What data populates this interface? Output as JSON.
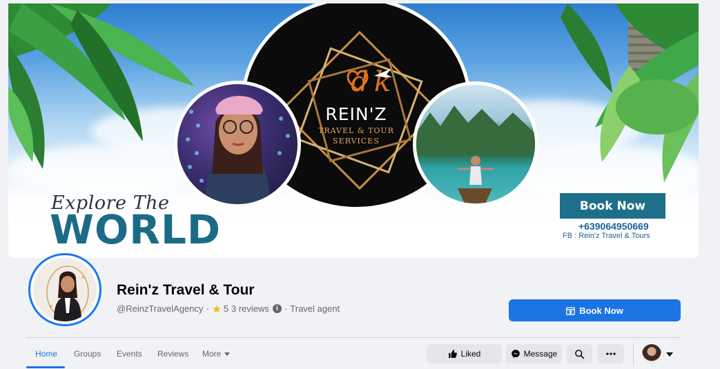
{
  "cover": {
    "brand_name": "REIN'Z",
    "brand_sub_1": "TRAVEL & TOUR",
    "brand_sub_2": "SERVICES",
    "explore": "Explore The",
    "world": "WORLD",
    "book_now": "Book Now",
    "phone": "+639064950669",
    "fb_line": "FB :  Rein'z Travel  & Tours"
  },
  "profile": {
    "name": "Rein'z Travel & Tour",
    "handle": "@ReinzTravelAgency",
    "sep": "·",
    "rating": "5",
    "reviews": "3 reviews",
    "category": "Travel agent"
  },
  "actions": {
    "book_now": "Book Now",
    "liked": "Liked",
    "message": "Message"
  },
  "tabs": [
    {
      "label": "Home",
      "active": true
    },
    {
      "label": "Groups"
    },
    {
      "label": "Events"
    },
    {
      "label": "Reviews"
    },
    {
      "label": "More"
    }
  ],
  "colors": {
    "accent": "#1b74e4",
    "cover_teal": "#1e6f8a",
    "world_text": "#1c6b86"
  }
}
